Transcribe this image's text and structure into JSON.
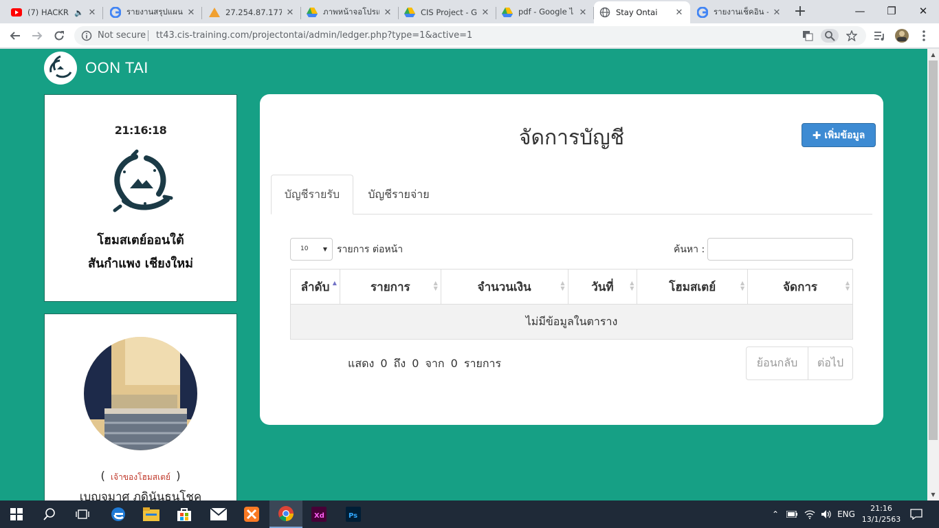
{
  "browser": {
    "tabs": [
      {
        "title": "(7) HACKR",
        "icon": "youtube-icon",
        "sound": true
      },
      {
        "title": "รายงานสรุปแผนลูก",
        "icon": "google-icon"
      },
      {
        "title": "27.254.87.177",
        "icon": "phpmyadmin-icon"
      },
      {
        "title": "ภาพหน้าจอโปรแก",
        "icon": "google-drive-icon"
      },
      {
        "title": "CIS Project - G",
        "icon": "google-drive-icon"
      },
      {
        "title": "pdf - Google ไ",
        "icon": "google-drive-icon"
      },
      {
        "title": "Stay Ontai",
        "icon": "globe-icon",
        "active": true
      },
      {
        "title": "รายงานเช็คอิน -",
        "icon": "google-icon"
      }
    ],
    "not_secure": "Not secure",
    "url": "tt43.cis-training.com/projectontai/admin/ledger.php?type=1&active=1"
  },
  "page": {
    "brand": "OON TAI",
    "clock": "21:16:18",
    "home_name": "โฮมสเตย์ออนใต้",
    "home_location": "สันกำแพง เชียงใหม่",
    "owner_role": "เจ้าของโฮมสเตย์",
    "owner_name": "เบญจมาศ ภดินันธนโชค",
    "title": "จัดการบัญชี",
    "add_button": "เพิ่มข้อมูล",
    "tabs": [
      "บัญชีรายรับ",
      "บัญชีรายจ่าย"
    ],
    "length_value": "10",
    "length_label": "รายการ ต่อหน้า",
    "search_label": "ค้นหา :",
    "columns": [
      "ลำดับ",
      "รายการ",
      "จำนวนเงิน",
      "วันที่",
      "โฮมสเตย์",
      "จัดการ"
    ],
    "empty_text": "ไม่มีข้อมูลในตาราง",
    "info_text": "แสดง 0 ถึง 0 จาก 0 รายการ",
    "prev": "ย้อนกลับ",
    "next": "ต่อไป"
  },
  "taskbar": {
    "apps": [
      "windows-start-icon",
      "search-icon",
      "task-view-icon",
      "edge-icon",
      "file-explorer-icon",
      "store-icon",
      "mail-icon",
      "xampp-icon",
      "chrome-icon",
      "adobe-xd-icon",
      "photoshop-icon"
    ],
    "language": "ENG",
    "time": "21:16",
    "date": "13/1/2563"
  },
  "colors": {
    "page_bg": "#16a085",
    "add_button": "#3d8bd3",
    "owner_role": "#c0392b"
  }
}
